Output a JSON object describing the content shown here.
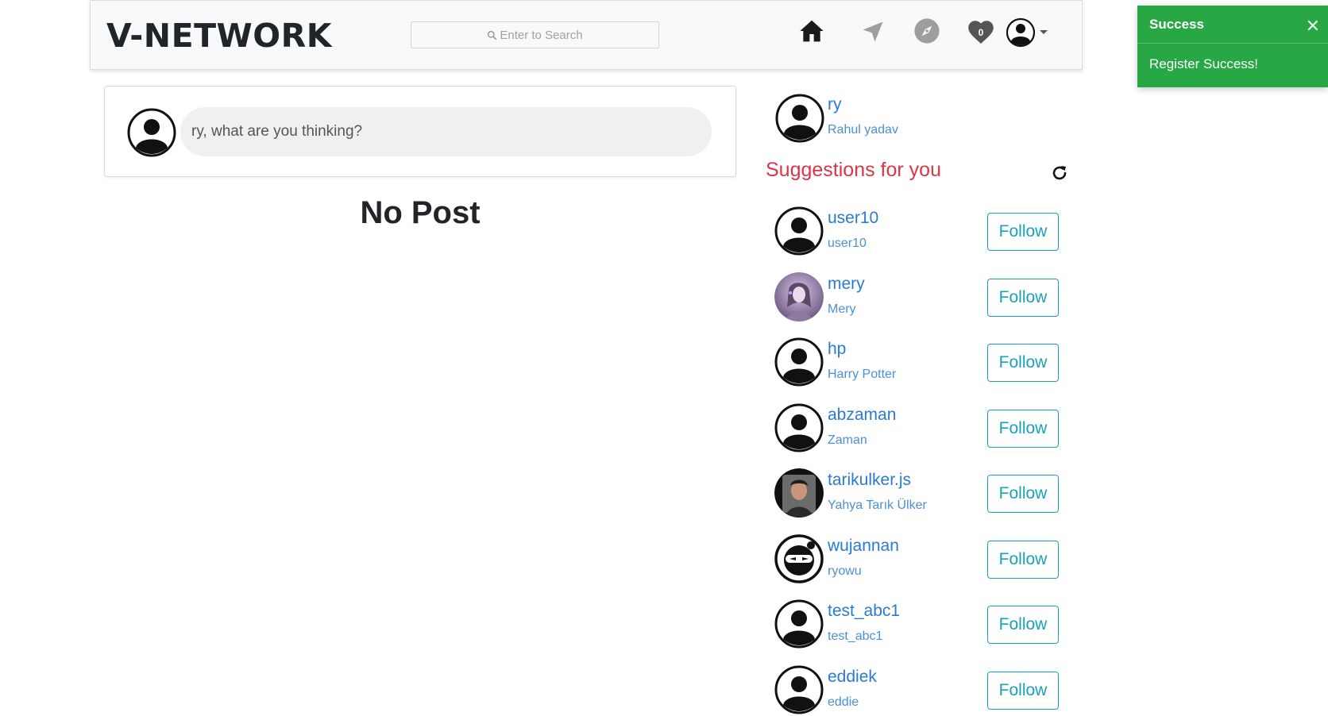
{
  "navbar": {
    "brand": "V-NETWORK",
    "search_placeholder": "Enter to Search",
    "notification_count": "0",
    "icons": [
      "home-icon",
      "send-icon",
      "explore-icon",
      "heart-icon",
      "avatar-icon",
      "caret-down-icon"
    ]
  },
  "toast": {
    "title": "Success",
    "message": "Register Success!",
    "close": "✕",
    "color": "#28a745"
  },
  "composer": {
    "placeholder": "ry, what are you thinking?"
  },
  "feed": {
    "empty_text": "No Post"
  },
  "current_user": {
    "username": "ry",
    "fullname": "Rahul yadav"
  },
  "suggestions": {
    "title": "Suggestions for you",
    "follow_label": "Follow",
    "items": [
      {
        "username": "user10",
        "fullname": "user10",
        "avatar": "default"
      },
      {
        "username": "mery",
        "fullname": "Mery",
        "avatar": "photo-purple"
      },
      {
        "username": "hp",
        "fullname": "Harry Potter",
        "avatar": "default"
      },
      {
        "username": "abzaman",
        "fullname": "Zaman",
        "avatar": "default"
      },
      {
        "username": "tarikulker.js",
        "fullname": "Yahya Tarık Ülker",
        "avatar": "photo-person"
      },
      {
        "username": "wujannan",
        "fullname": "ryowu",
        "avatar": "ninja"
      },
      {
        "username": "test_abc1",
        "fullname": "test_abc1",
        "avatar": "default"
      },
      {
        "username": "eddiek",
        "fullname": "eddie",
        "avatar": "default"
      }
    ]
  },
  "colors": {
    "link": "#2a7ad5",
    "accent_red": "#dc3545",
    "follow_teal": "#17a2b8"
  }
}
